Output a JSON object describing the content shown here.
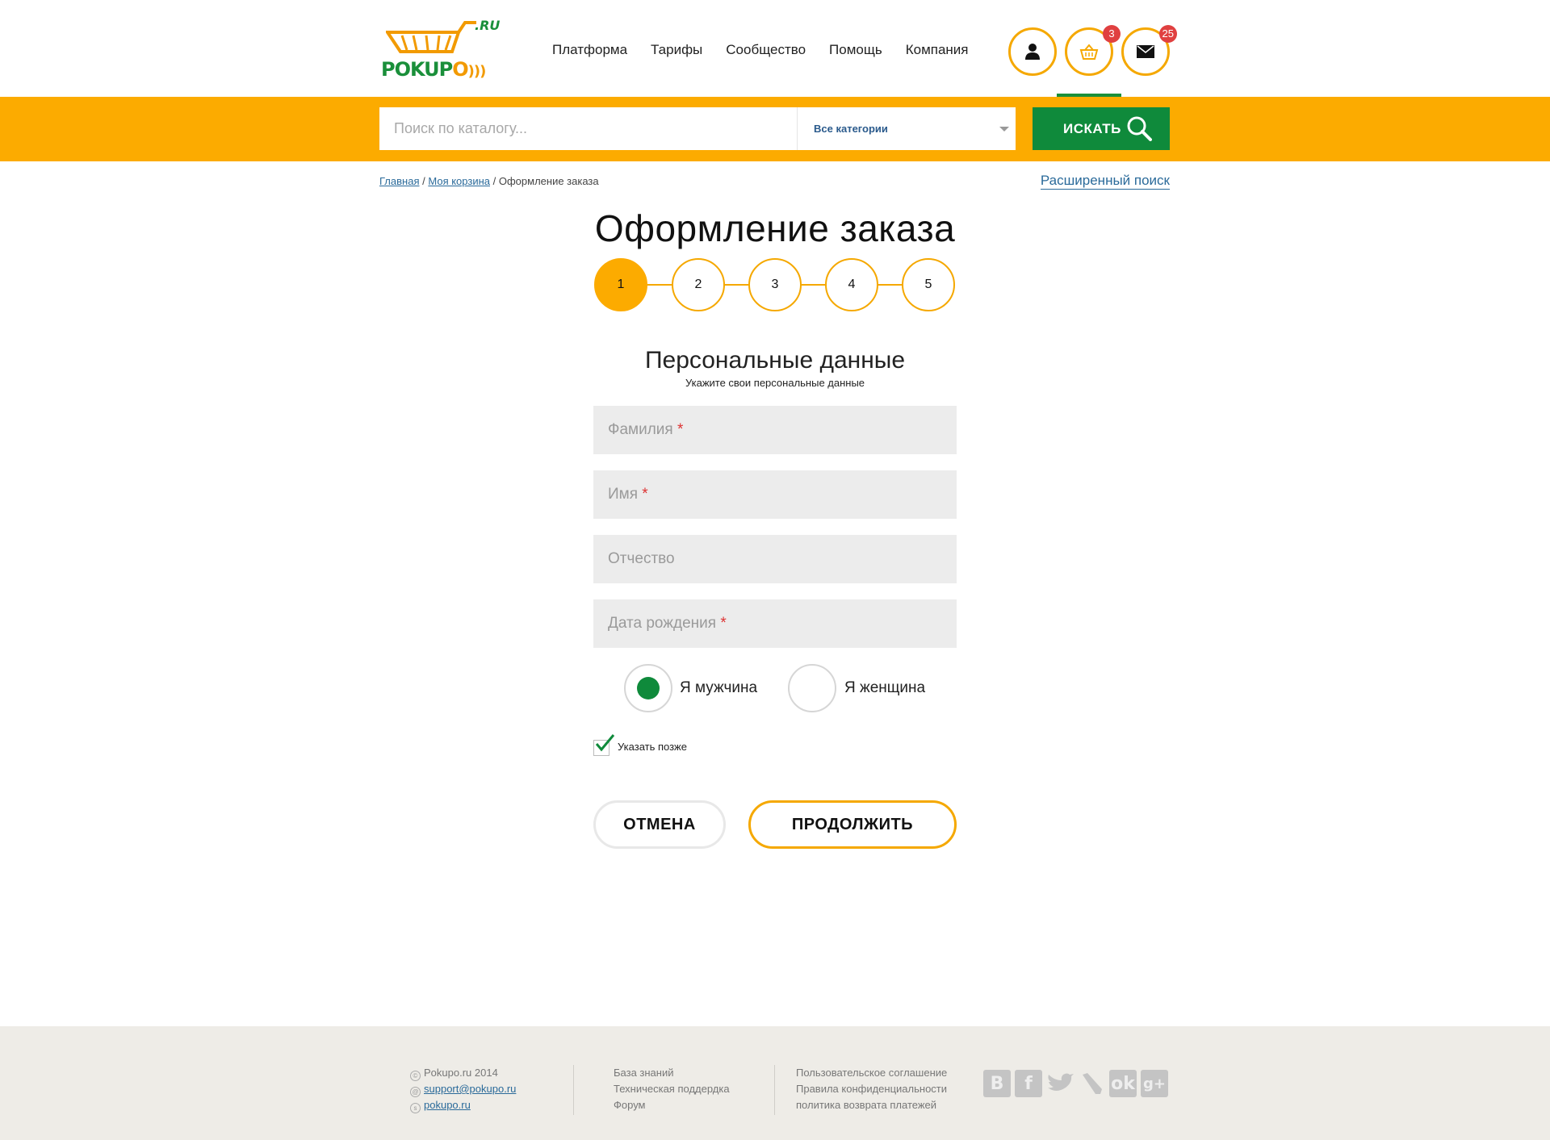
{
  "header": {
    "logo_text_green": "POKUP",
    "logo_text_orange": "O",
    "logo_ru": ".RU",
    "nav": [
      "Платформа",
      "Тарифы",
      "Сообщество",
      "Помощь",
      "Компания"
    ],
    "icons": {
      "user": "user-icon",
      "cart": "basket-icon",
      "mail": "envelope-icon"
    },
    "cart_count": "3",
    "mail_count": "25"
  },
  "search": {
    "placeholder": "Поиск по каталогу...",
    "category": "Все категории",
    "button": "ИСКАТЬ"
  },
  "breadcrumb": {
    "home": "Главная",
    "cart": "Моя корзина",
    "sep1": "/",
    "sep2": "/",
    "current": "Оформление заказа"
  },
  "advanced_search": "Расширенный поиск",
  "page_title": "Оформление заказа",
  "steps": [
    "1",
    "2",
    "3",
    "4",
    "5"
  ],
  "active_step": 1,
  "section": {
    "title": "Персональные данные",
    "subtitle": "Укажите свои персональные данные"
  },
  "form": {
    "last_name": "Фамилия",
    "first_name": "Имя",
    "patronymic": "Отчество",
    "birth_date": "Дата рождения",
    "required_mark": "*",
    "gender_male": "Я мужчина",
    "gender_female": "Я женщина",
    "gender_selected": "male",
    "later_label": "Указать позже",
    "later_checked": true,
    "cancel": "ОТМЕНА",
    "continue": "ПРОДОЛЖИТЬ"
  },
  "footer": {
    "copyright": "Pokupo.ru 2014",
    "email": "support@pokupo.ru",
    "skype": "pokupo.ru",
    "links_col2": [
      "База знаний",
      "Техническая поддердка",
      "Форум"
    ],
    "links_col3": [
      "Пользовательское соглашение",
      "Правила конфиденциальности",
      "политика возврата платежей"
    ],
    "social": [
      "vk-icon",
      "facebook-icon",
      "twitter-icon",
      "livejournal-icon",
      "odnoklassniki-icon",
      "google-plus-icon"
    ]
  },
  "colors": {
    "accent_orange": "#fcab00",
    "accent_green": "#0f8a3b",
    "badge_red": "#e04040"
  }
}
